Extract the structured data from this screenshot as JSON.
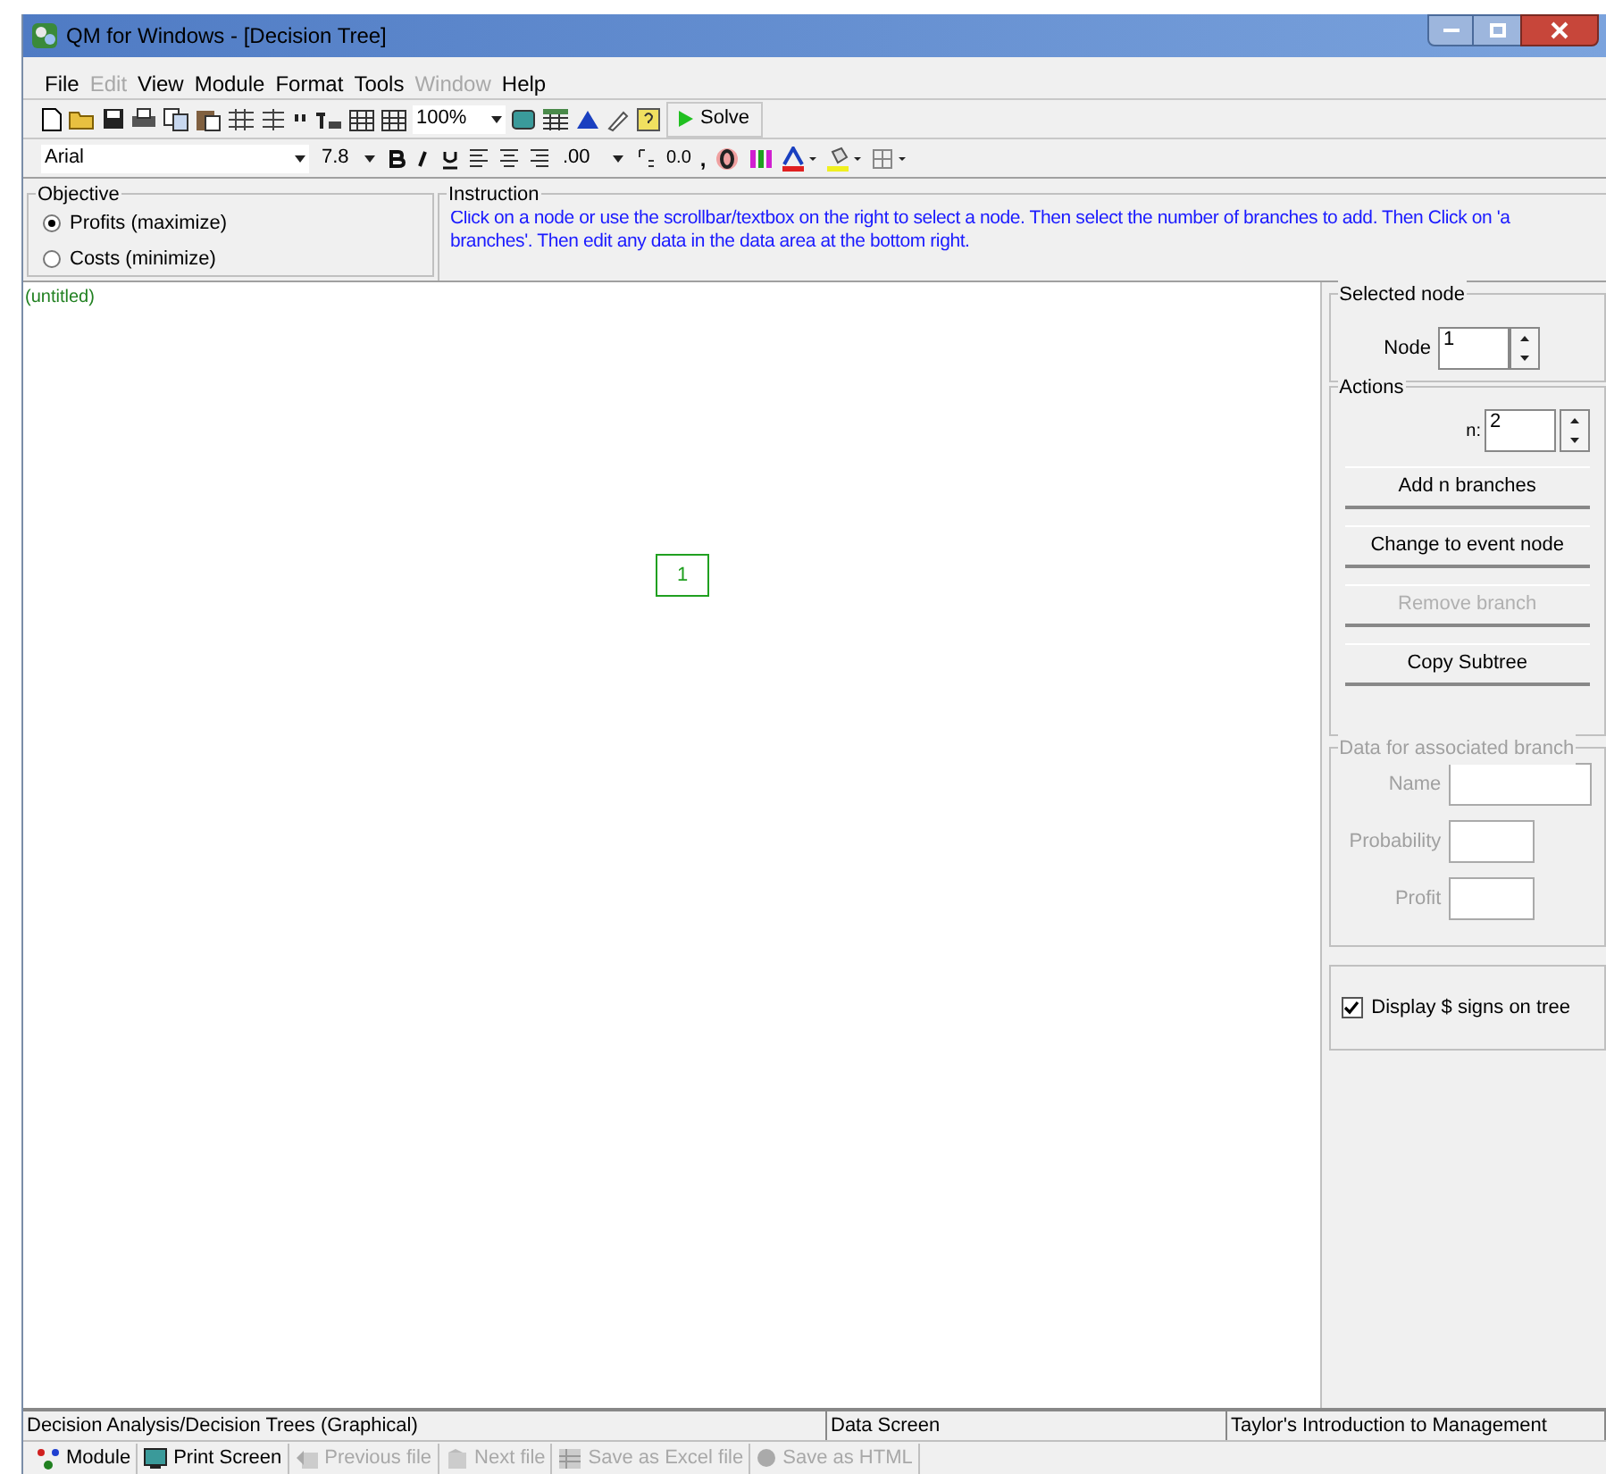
{
  "window": {
    "title": "QM for Windows - [Decision Tree]"
  },
  "menu": [
    {
      "label": "File",
      "disabled": false
    },
    {
      "label": "Edit",
      "disabled": true
    },
    {
      "label": "View",
      "disabled": false
    },
    {
      "label": "Module",
      "disabled": false
    },
    {
      "label": "Format",
      "disabled": false
    },
    {
      "label": "Tools",
      "disabled": false
    },
    {
      "label": "Window",
      "disabled": true
    },
    {
      "label": "Help",
      "disabled": false
    }
  ],
  "toolbar": {
    "zoom": "100%",
    "solve": "Solve"
  },
  "format_bar": {
    "font": "Arial",
    "size": "7.8",
    "decimals": ".00",
    "decimal_sample": "0.0",
    "comma": ","
  },
  "objective": {
    "title": "Objective",
    "options": [
      {
        "label": "Profits (maximize)",
        "selected": true
      },
      {
        "label": "Costs (minimize)",
        "selected": false
      }
    ]
  },
  "instruction": {
    "title": "Instruction",
    "text": "Click on a node or use the scrollbar/textbox on the right to select a node. Then select the number of branches to add. Then Click on 'a",
    "text_2": "branches'. Then edit any data in the data area at the bottom right."
  },
  "canvas": {
    "title": "(untitled)",
    "nodes": [
      {
        "label": "1"
      }
    ]
  },
  "selected_node": {
    "title": "Selected node",
    "label": "Node",
    "value": "1"
  },
  "actions": {
    "title": "Actions",
    "label": "n:",
    "value": "2",
    "buttons": [
      {
        "label": "Add n branches",
        "disabled": false
      },
      {
        "label": "Change to event node",
        "disabled": false
      },
      {
        "label": "Remove branch",
        "disabled": true
      },
      {
        "label": "Copy Subtree",
        "disabled": false
      }
    ]
  },
  "branch_data": {
    "title": "Data for associated branch",
    "fields": [
      {
        "label": "Name"
      },
      {
        "label": "Probability"
      },
      {
        "label": "Profit"
      }
    ]
  },
  "display_dollar": {
    "label": "Display $ signs on tree",
    "checked": true
  },
  "status_bar": [
    "Decision Analysis/Decision Trees (Graphical)",
    "Data Screen",
    "Taylor's Introduction to Management"
  ],
  "bottom_toolbar": [
    {
      "label": "Module",
      "disabled": false
    },
    {
      "label": "Print Screen",
      "disabled": false
    },
    {
      "label": "Previous file",
      "disabled": true
    },
    {
      "label": "Next file",
      "disabled": true
    },
    {
      "label": "Save as Excel file",
      "disabled": true
    },
    {
      "label": "Save as HTML",
      "disabled": true
    }
  ]
}
